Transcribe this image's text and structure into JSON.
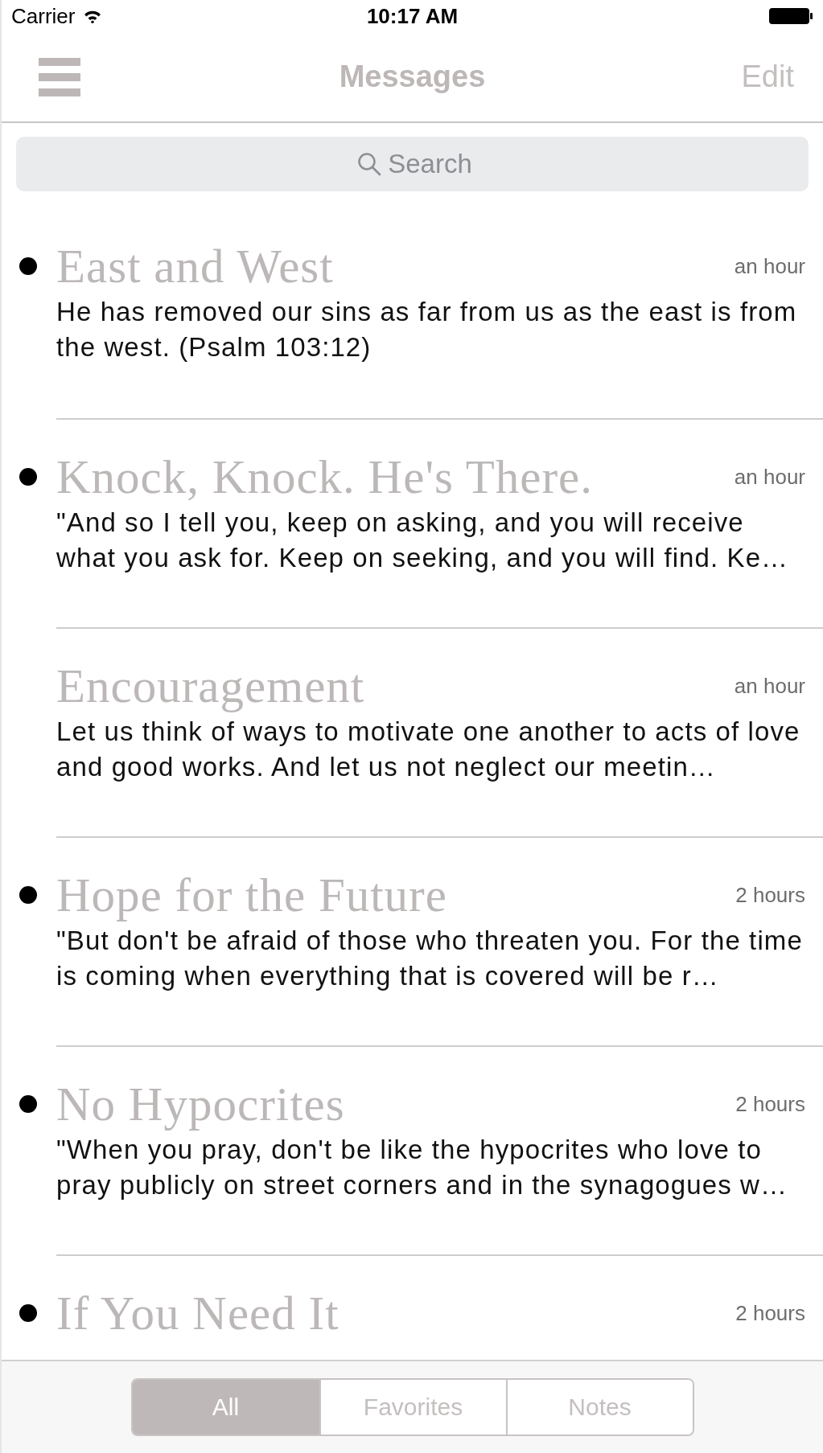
{
  "status_bar": {
    "carrier": "Carrier",
    "time": "10:17 AM"
  },
  "nav": {
    "title": "Messages",
    "edit": "Edit"
  },
  "search": {
    "placeholder": "Search"
  },
  "messages": [
    {
      "title": "East and West",
      "time": "an hour",
      "unread": true,
      "preview": "He has removed our sins as far from us as the east is from the west. (Psalm 103:12)"
    },
    {
      "title": "Knock, Knock. He's There.",
      "time": "an hour",
      "unread": true,
      "preview": "\"And so I tell you, keep on asking, and you will receive what you ask for. Keep on seeking, and you will find. Ke…"
    },
    {
      "title": "Encouragement",
      "time": "an hour",
      "unread": false,
      "preview": "Let us think of ways to motivate one another to acts of love and good works. And let us not neglect our meetin…"
    },
    {
      "title": "Hope for the Future",
      "time": "2 hours",
      "unread": true,
      "preview": "\"But don't be afraid of those who threaten you. For the time is coming when everything that is covered will be r…"
    },
    {
      "title": "No Hypocrites",
      "time": "2 hours",
      "unread": true,
      "preview": "\"When you pray, don't be like the hypocrites who love to pray publicly on street corners and in the synagogues w…"
    },
    {
      "title": "If You Need It",
      "time": "2 hours",
      "unread": true
    }
  ],
  "filter_tabs": [
    {
      "label": "All",
      "selected": true
    },
    {
      "label": "Favorites",
      "selected": false
    },
    {
      "label": "Notes",
      "selected": false
    }
  ]
}
